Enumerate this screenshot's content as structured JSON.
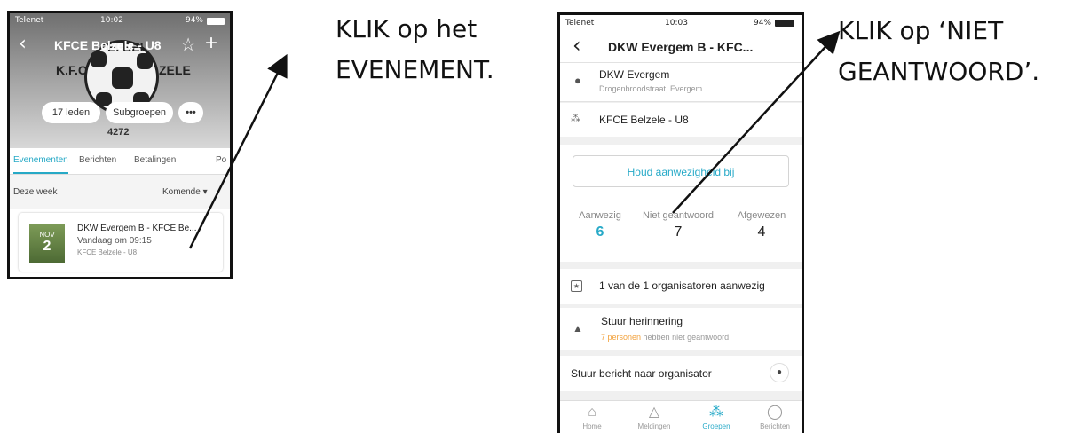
{
  "phone1": {
    "status": {
      "carrier": "Telenet",
      "time": "10:02",
      "battery": "94%"
    },
    "nav": {
      "back_icon": "‹",
      "title": "KFCE Belzele - U8",
      "star_icon": "☆",
      "plus_icon": "+"
    },
    "logo_text": {
      "left": "K.F.C",
      "top": "E. BEL",
      "right": "ZELE",
      "code": "4272"
    },
    "pills": {
      "members": "17 leden",
      "subgroups": "Subgroepen",
      "more": "•••"
    },
    "tabs": [
      "Evenementen",
      "Berichten",
      "Betalingen",
      "Po"
    ],
    "week": {
      "label": "Deze week",
      "filter": "Komende ▾"
    },
    "event": {
      "thumb_month": "NOV",
      "thumb_day": "2",
      "title": "DKW Evergem B - KFCE Be...",
      "time": "Vandaag om 09:15",
      "group": "KFCE Belzele - U8"
    }
  },
  "instructions": {
    "first": "KLIK op het EVENEMENT.",
    "second": "KLIK op ‘NIET GEANTWOORD’."
  },
  "phone2": {
    "status": {
      "carrier": "Telenet",
      "time": "10:03",
      "battery": "94%"
    },
    "nav": {
      "back_icon": "‹",
      "title": "DKW Evergem B - KFC..."
    },
    "location": {
      "name": "DKW Evergem",
      "address": "Drogenbroodstraat, Evergem"
    },
    "group": "KFCE Belzele - U8",
    "attendance_button": "Houd aanwezigheid bij",
    "counts": [
      {
        "label": "Aanwezig",
        "value": "6"
      },
      {
        "label": "Niet geantwoord",
        "value": "7"
      },
      {
        "label": "Afgewezen",
        "value": "4"
      }
    ],
    "organizers": "1 van de 1 organisatoren aanwezig",
    "reminder": {
      "title": "Stuur herinnering",
      "highlight": "7 personen",
      "rest": " hebben niet geantwoord"
    },
    "message": "Stuur bericht naar organisator",
    "tabbar": [
      {
        "label": "Home",
        "icon": "home-icon"
      },
      {
        "label": "Meldingen",
        "icon": "bell-icon"
      },
      {
        "label": "Groepen",
        "icon": "groups-icon"
      },
      {
        "label": "Berichten",
        "icon": "chat-icon"
      }
    ]
  },
  "colors": {
    "accent": "#28aac8",
    "highlight": "#f2a23d"
  }
}
